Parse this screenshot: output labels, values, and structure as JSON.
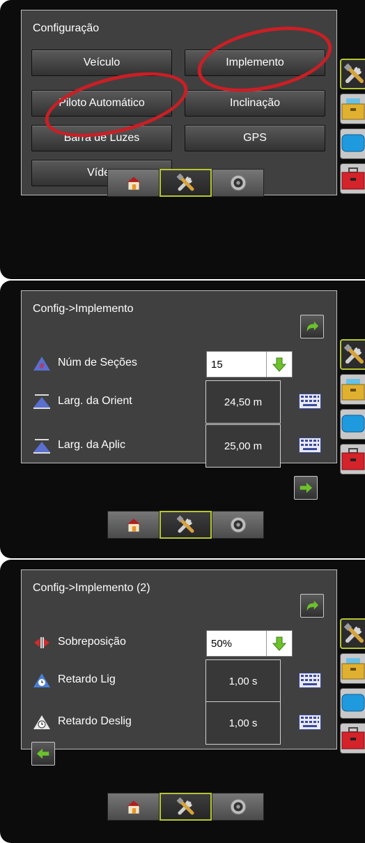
{
  "panel1": {
    "title": "Configuração",
    "buttons": [
      "Veículo",
      "Implemento",
      "Piloto Automático",
      "Inclinação",
      "Barra de Luzes",
      "GPS",
      "Vídeo"
    ]
  },
  "panel2": {
    "title": "Config->Implemento",
    "sections_label": "Núm de Seções",
    "sections_value": "15",
    "guidance_width_label": "Larg. da Orient",
    "guidance_width_value": "24,50 m",
    "application_width_label": "Larg. da Aplic",
    "application_width_value": "25,00 m"
  },
  "panel3": {
    "title": "Config->Implemento (2)",
    "overlap_label": "Sobreposição",
    "overlap_value": "50%",
    "delay_on_label": "Retardo Lig",
    "delay_on_value": "1,00 s",
    "delay_off_label": "Retardo Deslig",
    "delay_off_value": "1,00 s"
  },
  "colors": {
    "highlight_ring": "#c91f25",
    "active_border": "#b7c630",
    "arrow_green": "#6cc22a"
  },
  "icons": [
    "home-icon",
    "tools-icon",
    "gauge-icon",
    "toolbox-icon",
    "keyboard-icon",
    "return-arrow-icon",
    "next-arrow-icon",
    "back-arrow-icon",
    "down-arrow-icon"
  ]
}
